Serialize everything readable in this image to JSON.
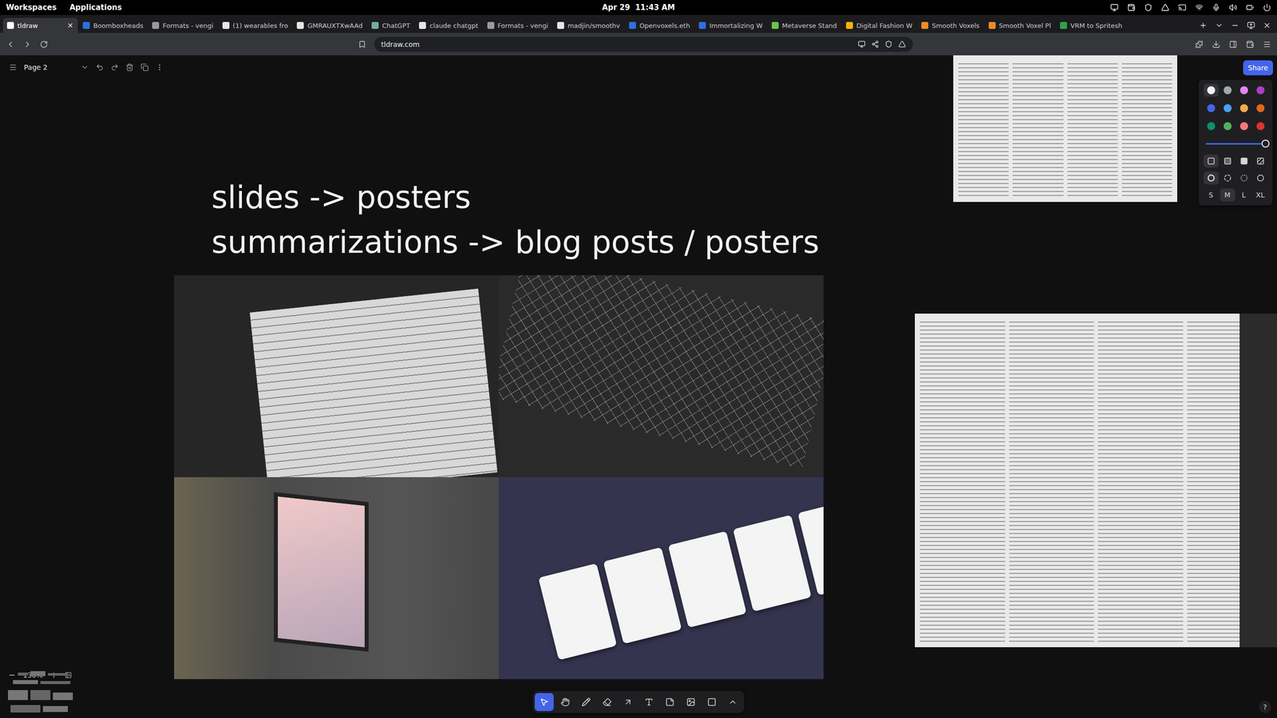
{
  "system_bar": {
    "workspaces": "Workspaces",
    "applications": "Applications",
    "clock": "Apr 29  11:43 AM"
  },
  "tabs": [
    {
      "label": "tldraw",
      "selected": true,
      "color": "#ffffff"
    },
    {
      "label": "Boomboxheads",
      "selected": false,
      "color": "#2f6fe0"
    },
    {
      "label": "Formats - vengi",
      "selected": false,
      "color": "#9a9a9a"
    },
    {
      "label": "(1) wearables fro",
      "selected": false,
      "color": "#e6e6e6"
    },
    {
      "label": "GMRAUXTXwAAd",
      "selected": false,
      "color": "#e6e6e6"
    },
    {
      "label": "ChatGPT",
      "selected": false,
      "color": "#74aa9c"
    },
    {
      "label": "claude chatgpt",
      "selected": false,
      "color": "#e6e6e6"
    },
    {
      "label": "Formats - vengi",
      "selected": false,
      "color": "#9a9a9a"
    },
    {
      "label": "madjin/smoothv",
      "selected": false,
      "color": "#e6e6e6"
    },
    {
      "label": "Openvoxels.eth",
      "selected": false,
      "color": "#2f6fe0"
    },
    {
      "label": "Immortalizing W",
      "selected": false,
      "color": "#2f6fe0"
    },
    {
      "label": "Metaverse Stand",
      "selected": false,
      "color": "#6cc24a"
    },
    {
      "label": "Digital Fashion W",
      "selected": false,
      "color": "#f4b400"
    },
    {
      "label": "Smooth Voxels",
      "selected": false,
      "color": "#f08a24"
    },
    {
      "label": "Smooth Voxel Pl",
      "selected": false,
      "color": "#f08a24"
    },
    {
      "label": "VRM to Spritesh",
      "selected": false,
      "color": "#2da44e"
    }
  ],
  "address_bar": {
    "url": "tldraw.com"
  },
  "page_menu": {
    "page": "Page 2"
  },
  "canvas": {
    "heading_lines": [
      "slides -> posters",
      "summarizations -> blog posts / posters"
    ]
  },
  "share_button": "Share",
  "style_panel": {
    "colors": [
      {
        "color": "#f2f2f2",
        "selected": true
      },
      {
        "color": "#9fa8b2",
        "selected": false
      },
      {
        "color": "#e085f4",
        "selected": false
      },
      {
        "color": "#ae3ec9",
        "selected": false
      },
      {
        "color": "#4465e9",
        "selected": false
      },
      {
        "color": "#4ba1f1",
        "selected": false
      },
      {
        "color": "#f1ac4b",
        "selected": false
      },
      {
        "color": "#e16919",
        "selected": false
      },
      {
        "color": "#099268",
        "selected": false
      },
      {
        "color": "#4cb05e",
        "selected": false
      },
      {
        "color": "#f87777",
        "selected": false
      },
      {
        "color": "#e03131",
        "selected": false
      }
    ],
    "opacity": {
      "level": 1
    },
    "fills": [
      {
        "kind": "none",
        "selected": true
      },
      {
        "kind": "semi",
        "selected": false
      },
      {
        "kind": "solid",
        "selected": false
      },
      {
        "kind": "pattern",
        "selected": false
      }
    ],
    "dashes": [
      {
        "kind": "draw",
        "selected": true
      },
      {
        "kind": "dashed",
        "selected": false
      },
      {
        "kind": "dotted",
        "selected": false
      },
      {
        "kind": "solid",
        "selected": false
      }
    ],
    "sizes": [
      {
        "label": "S",
        "selected": false
      },
      {
        "label": "M",
        "selected": true
      },
      {
        "label": "L",
        "selected": false
      },
      {
        "label": "XL",
        "selected": false
      }
    ]
  },
  "zoom": {
    "value": "130%"
  },
  "toolbar": [
    {
      "kind": "select",
      "selected": true
    },
    {
      "kind": "hand",
      "selected": false
    },
    {
      "kind": "draw",
      "selected": false
    },
    {
      "kind": "eraser",
      "selected": false
    },
    {
      "kind": "arrow",
      "selected": false
    },
    {
      "kind": "text",
      "selected": false
    },
    {
      "kind": "note",
      "selected": false
    },
    {
      "kind": "asset",
      "selected": false
    },
    {
      "kind": "rectangle",
      "selected": false
    },
    {
      "kind": "more",
      "selected": false
    }
  ],
  "help": "?"
}
